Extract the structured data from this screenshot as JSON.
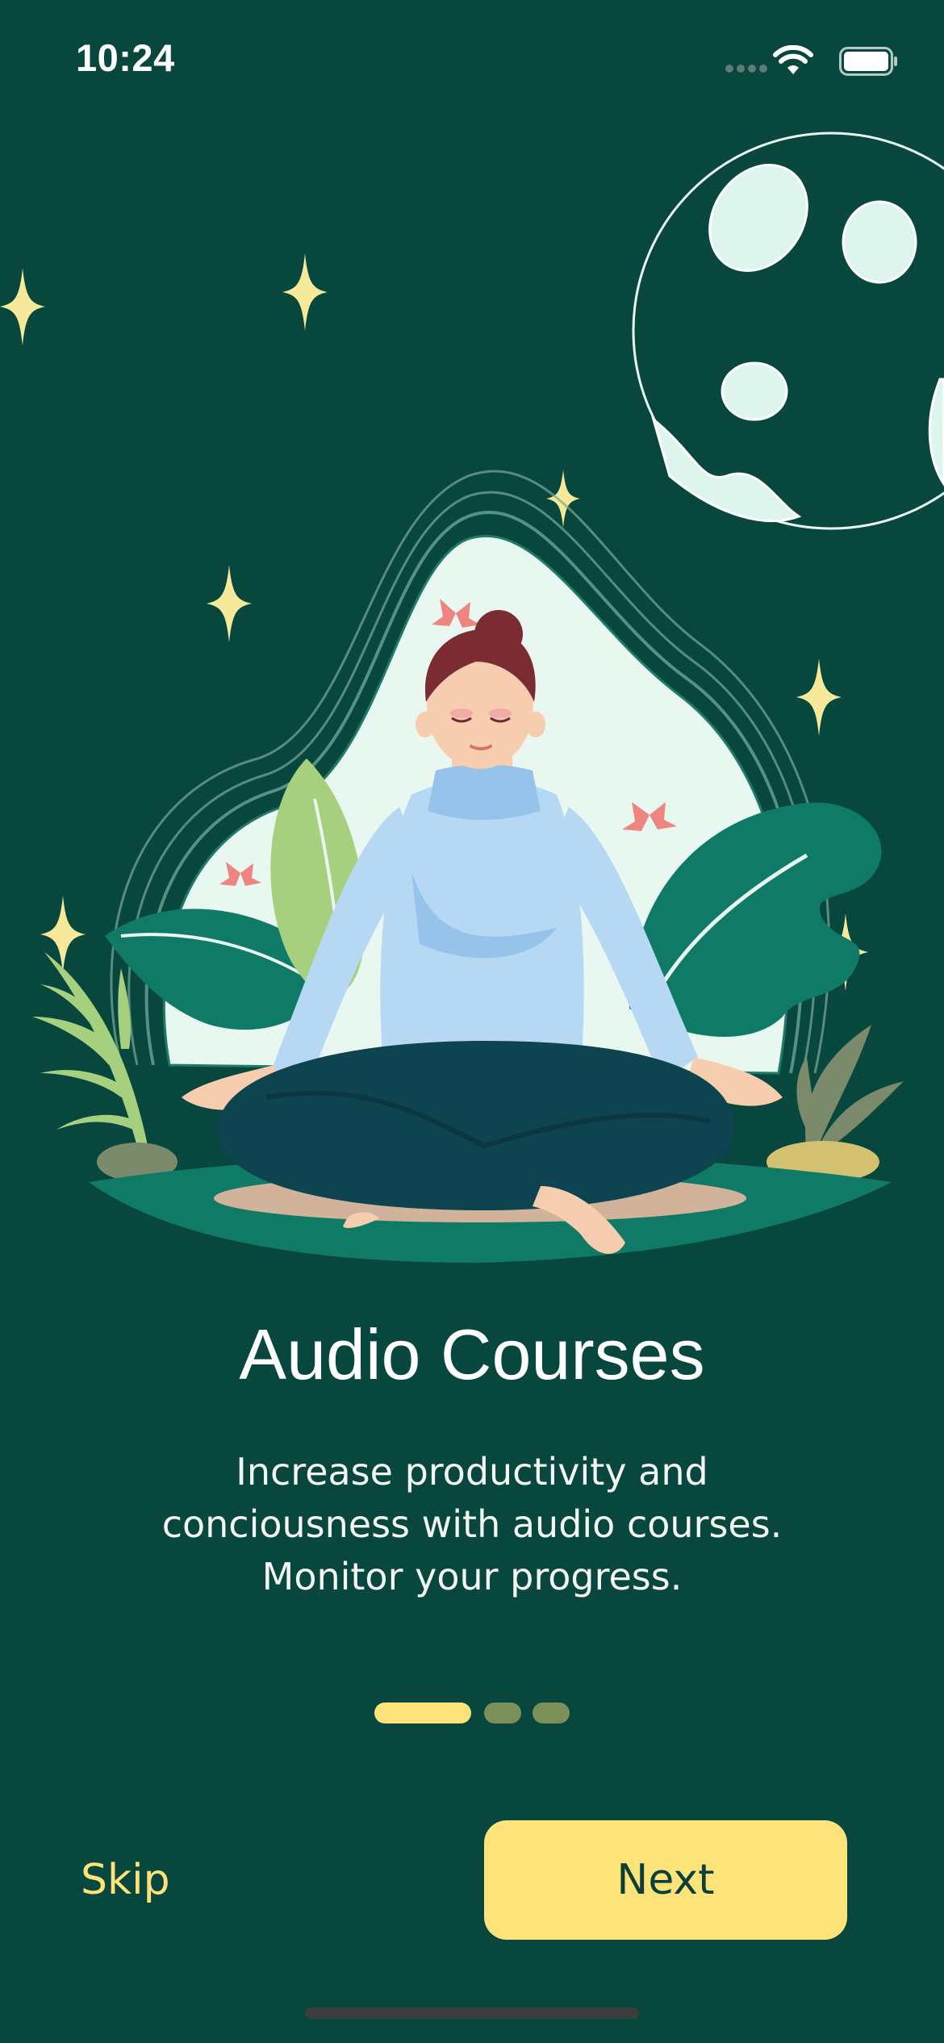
{
  "status_bar": {
    "time": "10:24",
    "icons": [
      "signal-dots-icon",
      "wifi-icon",
      "battery-icon"
    ]
  },
  "illustration": {
    "subject": "woman-meditating",
    "elements": [
      "moon",
      "sparkle-stars",
      "leaves",
      "butterflies"
    ]
  },
  "onboarding": {
    "title": "Audio Courses",
    "description_lines": [
      "Increase productivity and",
      "conciousness with audio courses.",
      "Monitor your progress."
    ],
    "page_indicator": {
      "current": 1,
      "total": 3
    }
  },
  "actions": {
    "skip_label": "Skip",
    "next_label": "Next"
  },
  "colors": {
    "background": "#08473d",
    "accent": "#fde37a",
    "inactive_dot": "#7b9059",
    "button_text": "#0c3f37"
  }
}
